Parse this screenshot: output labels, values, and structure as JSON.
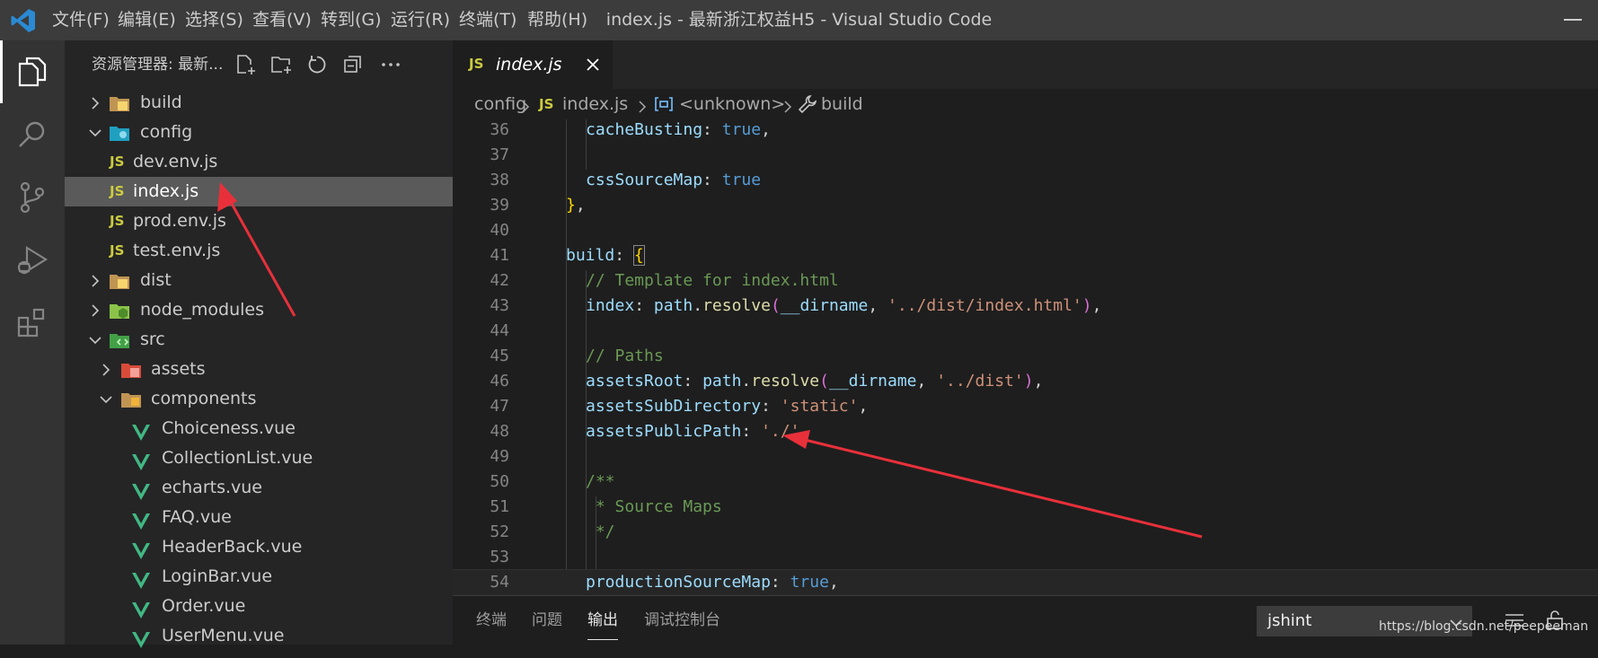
{
  "titlebar": {
    "menu": [
      "文件(F)",
      "编辑(E)",
      "选择(S)",
      "查看(V)",
      "转到(G)",
      "运行(R)",
      "终端(T)",
      "帮助(H)"
    ],
    "window_title": "index.js - 最新浙江权益H5 - Visual Studio Code"
  },
  "activity_bar": {
    "items": [
      "files-icon",
      "search-icon",
      "source-control-icon",
      "run-debug-icon",
      "extensions-icon"
    ],
    "active": "files-icon"
  },
  "sidebar": {
    "title": "资源管理器: 最新...",
    "actions": [
      "new-file-icon",
      "new-folder-icon",
      "refresh-icon",
      "collapse-all-icon",
      "more-icon"
    ],
    "tree": [
      {
        "label": "build",
        "type": "folder",
        "expanded": false,
        "depth": 0
      },
      {
        "label": "config",
        "type": "folder",
        "expanded": true,
        "depth": 0
      },
      {
        "label": "dev.env.js",
        "type": "js",
        "depth": 1
      },
      {
        "label": "index.js",
        "type": "js",
        "depth": 1,
        "selected": true
      },
      {
        "label": "prod.env.js",
        "type": "js",
        "depth": 1
      },
      {
        "label": "test.env.js",
        "type": "js",
        "depth": 1
      },
      {
        "label": "dist",
        "type": "folder",
        "expanded": false,
        "depth": 0
      },
      {
        "label": "node_modules",
        "type": "folder",
        "expanded": false,
        "depth": 0
      },
      {
        "label": "src",
        "type": "folder",
        "expanded": true,
        "depth": 0
      },
      {
        "label": "assets",
        "type": "folder",
        "expanded": false,
        "depth": 1
      },
      {
        "label": "components",
        "type": "folder",
        "expanded": true,
        "depth": 1
      },
      {
        "label": "Choiceness.vue",
        "type": "vue",
        "depth": 2
      },
      {
        "label": "CollectionList.vue",
        "type": "vue",
        "depth": 2
      },
      {
        "label": "echarts.vue",
        "type": "vue",
        "depth": 2
      },
      {
        "label": "FAQ.vue",
        "type": "vue",
        "depth": 2
      },
      {
        "label": "HeaderBack.vue",
        "type": "vue",
        "depth": 2
      },
      {
        "label": "LoginBar.vue",
        "type": "vue",
        "depth": 2
      },
      {
        "label": "Order.vue",
        "type": "vue",
        "depth": 2
      },
      {
        "label": "UserMenu.vue",
        "type": "vue",
        "depth": 2
      }
    ]
  },
  "editor": {
    "tab": {
      "badge": "JS",
      "label": "index.js"
    },
    "breadcrumb": {
      "folder": "config",
      "badge": "JS",
      "file": "index.js",
      "symbol": "<unknown>",
      "property": "build"
    },
    "current_line": 54,
    "lines": [
      {
        "n": "36",
        "code": "cacheBusting: true,"
      },
      {
        "n": "37",
        "code": ""
      },
      {
        "n": "38",
        "code": "cssSourceMap: true"
      },
      {
        "n": "39",
        "code": "},"
      },
      {
        "n": "40",
        "code": ""
      },
      {
        "n": "41",
        "code": "build: {"
      },
      {
        "n": "42",
        "code": "// Template for index.html"
      },
      {
        "n": "43",
        "code": "index: path.resolve(__dirname, '../dist/index.html'),"
      },
      {
        "n": "44",
        "code": ""
      },
      {
        "n": "45",
        "code": "// Paths"
      },
      {
        "n": "46",
        "code": "assetsRoot: path.resolve(__dirname, '../dist'),"
      },
      {
        "n": "47",
        "code": "assetsSubDirectory: 'static',"
      },
      {
        "n": "48",
        "code": "assetsPublicPath: './',"
      },
      {
        "n": "49",
        "code": ""
      },
      {
        "n": "50",
        "code": "/**"
      },
      {
        "n": "51",
        "code": " * Source Maps"
      },
      {
        "n": "52",
        "code": " */"
      },
      {
        "n": "53",
        "code": ""
      },
      {
        "n": "54",
        "code": "productionSourceMap: true,"
      }
    ]
  },
  "panel": {
    "tabs": [
      "终端",
      "问题",
      "输出",
      "调试控制台"
    ],
    "active_tab": "输出",
    "output_channel": "jshint"
  },
  "watermark": "https://blog.csdn.net/peepeeman",
  "colors": {
    "titlebar": "#3c3c3c",
    "activitybar": "#333333",
    "sidebar": "#252526",
    "editor": "#1e1e1e",
    "selection": "#5a5a5a",
    "annotation_arrow": "#e8303a"
  }
}
